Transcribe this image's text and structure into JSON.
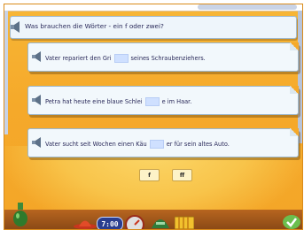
{
  "question": {
    "text": "Was brauchen die Wörter - ein f oder zwei?"
  },
  "sentences": [
    {
      "before": "Vater repariert den Gri",
      "after": "seines Schraubenziehers."
    },
    {
      "before": "Petra hat heute eine blaue Schlei",
      "after": "e im Haar."
    },
    {
      "before": "Vater sucht seit Wochen einen Käu",
      "after": "er für sein altes Auto."
    }
  ],
  "choices": [
    {
      "label": "f"
    },
    {
      "label": "ff"
    }
  ],
  "toolbar": {
    "clock_value": "7:00",
    "icons": [
      "bottle-icon",
      "hat-icon",
      "clock-icon",
      "gauge-icon",
      "helmet-icon",
      "book-icon",
      "checkmark-icon"
    ]
  },
  "colors": {
    "background": "#f5a92a",
    "card": "#f2f8fc",
    "gap": "#cfe0ff",
    "text": "#2a2a5a"
  }
}
